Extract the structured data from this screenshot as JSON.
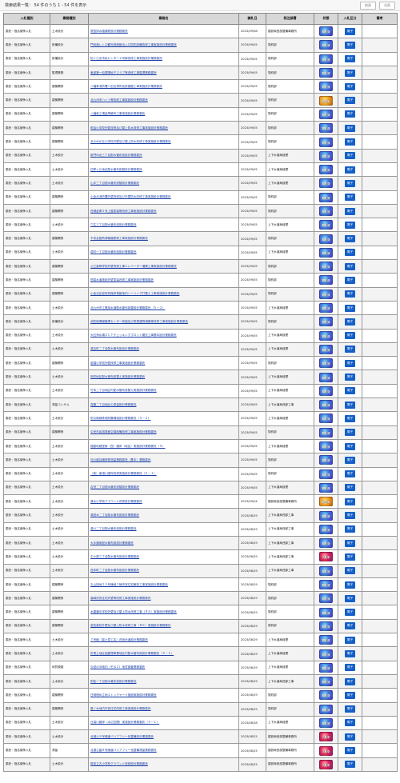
{
  "header": {
    "title": "検索結果一覧： 54 件のうち 1 - 54 件を表示",
    "prev_label": "前頁",
    "next_label": "次頁"
  },
  "columns": [
    "入札種別",
    "業務種別",
    "業務名",
    "開札日",
    "発注部署",
    "状態",
    "入札区分",
    "備考"
  ],
  "colors": {
    "badge_blue": "#3a7fe0",
    "badge_orange": "#f0a020",
    "badge_red": "#e02050",
    "link": "#1a3fa6"
  },
  "rows": [
    {
      "type": "委託・指名競争入札",
      "category": "土木設計",
      "name": "霧島排水路補修設計業務委託",
      "date": "2023/09/08",
      "dept": "建設局西部整備事務所",
      "status": "blue",
      "status_label": "開札済",
      "pdf": "電子"
    },
    {
      "type": "委託・指名競争入札",
      "category": "設備設計",
      "name": "門司港レトロ観光物産館出入口防犯設備改修工事実施設計業務委託",
      "date": "2023/09/05",
      "dept": "契約部",
      "status": "blue",
      "status_label": "開札済",
      "pdf": "電子"
    },
    {
      "type": "委託・指名競争入札",
      "category": "設備設計",
      "name": "松ヶ江北市民センター２号扉改修工事実施設計業務委託",
      "date": "2023/09/05",
      "dept": "契約部",
      "status": "blue",
      "status_label": "開札済",
      "pdf": "電子"
    },
    {
      "type": "委託・指名競争入札",
      "category": "監理業務",
      "name": "東部第一処理場地下スラブ等改修工事監理業務委託",
      "date": "2023/09/05",
      "dept": "契約部",
      "status": "blue",
      "status_label": "開札済",
      "pdf": "電子"
    },
    {
      "type": "委託・指名競争入札",
      "category": "建築関係",
      "name": "八幡東消防署八田出張所仮設建屋工事実施設計業務委託",
      "date": "2023/09/05",
      "dept": "契約部",
      "status": "blue",
      "status_label": "開札済",
      "pdf": "電子"
    },
    {
      "type": "委託・指名競争入札",
      "category": "建築関係",
      "name": "北九州市ハイツ等改修工事実施設計業務委託",
      "date": "2023/09/05",
      "dept": "契約部",
      "status": "orange",
      "status_label": "取止め",
      "pdf": "電子"
    },
    {
      "type": "委託・指名競争入札",
      "category": "建築関係",
      "name": "八幡東工場倉庫解体工事実施設計業務委託",
      "date": "2023/09/05",
      "dept": "契約部",
      "status": "blue",
      "status_label": "開札済",
      "pdf": "電子"
    },
    {
      "type": "委託・指名競争入札",
      "category": "建築関係",
      "name": "明治小学校外壁改修及び屋上防水改修工事実施設計業務委託",
      "date": "2023/09/05",
      "dept": "契約部",
      "status": "blue",
      "status_label": "開札済",
      "pdf": "電子"
    },
    {
      "type": "委託・指名競争入札",
      "category": "建築関係",
      "name": "あやめが丘小学校外壁及び屋上防水改修工事実施設計業務委託",
      "date": "2023/09/05",
      "dept": "契約部",
      "status": "blue",
      "status_label": "開札済",
      "pdf": "電子"
    },
    {
      "type": "委託・指名競争入札",
      "category": "土木設計",
      "name": "新門司北三丁目配水管布設設計業務委託",
      "date": "2023/09/05",
      "dept": "上下水道局経理",
      "status": "blue",
      "status_label": "開札済",
      "pdf": "電子"
    },
    {
      "type": "委託・指名競争入札",
      "category": "土木設計",
      "name": "四季ヶ丘地区配水管布設替設計業務委託",
      "date": "2023/09/05",
      "dept": "上下水道局経理",
      "status": "blue",
      "status_label": "開札済",
      "pdf": "電子"
    },
    {
      "type": "委託・指名競争入札",
      "category": "土木設計",
      "name": "山手三丁目配水管布設替設計業務委託",
      "date": "2023/09/05",
      "dept": "上下水道局経理",
      "status": "blue",
      "status_label": "開札済",
      "pdf": "電子"
    },
    {
      "type": "委託・指名競争入札",
      "category": "建築関係",
      "name": "小倉北消防署外壁改修及び外壁防水改修工事実施設計業務委託",
      "date": "2023/09/05",
      "dept": "契約部",
      "status": "blue",
      "status_label": "開札済",
      "pdf": "電子"
    },
    {
      "type": "委託・指名競争入札",
      "category": "建築関係",
      "name": "西港倉庫５号上屋塗装等改修工事実施設計業務委託",
      "date": "2023/09/05",
      "dept": "契約部",
      "status": "blue",
      "status_label": "開札済",
      "pdf": "電子"
    },
    {
      "type": "委託・指名競争入札",
      "category": "土木設計",
      "name": "穴生三丁目配水管布設設計業務委託",
      "date": "2023/09/05",
      "dept": "上下水道局経理",
      "status": "blue",
      "status_label": "開札済",
      "pdf": "電子"
    },
    {
      "type": "委託・指名競争入札",
      "category": "建築関係",
      "name": "不老会館熱源機器更新工事実施設計業務委託",
      "date": "2023/09/05",
      "dept": "契約部",
      "status": "blue",
      "status_label": "開札済",
      "pdf": "電子"
    },
    {
      "type": "委託・指名競争入札",
      "category": "土木設計",
      "name": "葛町一丁目配水管布設設計業務委託",
      "date": "2023/09/05",
      "dept": "上下水道局経理",
      "status": "blue",
      "status_label": "開札済",
      "pdf": "電子"
    },
    {
      "type": "委託・指名競争入札",
      "category": "建築関係",
      "name": "公立高等学校外壁改修工事エレベーター増築工事実施設計業務委託",
      "date": "2023/09/05",
      "dept": "契約部",
      "status": "blue",
      "status_label": "開札済",
      "pdf": "電子"
    },
    {
      "type": "委託・指名競争入札",
      "category": "建築関係",
      "name": "簡易水道施設外壁塗装改修工事実施設計業務委託",
      "date": "2023/09/05",
      "dept": "契約部",
      "status": "blue",
      "status_label": "開札済",
      "pdf": "電子"
    },
    {
      "type": "委託・指名競争入札",
      "category": "建築関係",
      "name": "小倉北区役所別館体育館地内シーリング打替え工事実施設計業務委託",
      "date": "2023/09/05",
      "dept": "契約部",
      "status": "blue",
      "status_label": "開札済",
      "pdf": "電子"
    },
    {
      "type": "委託・指名競争入札",
      "category": "土木設計",
      "name": "北九州市工業用水道配水管布設替設計業務委託（５－２）",
      "date": "2023/09/05",
      "dept": "上下水道局経理",
      "status": "blue",
      "status_label": "開札済",
      "pdf": "電子"
    },
    {
      "type": "委託・指名競争入札",
      "category": "設備設計",
      "name": "消防局情報管理センター別館及び附属建物増築等改修工事実施設計業務委託",
      "date": "2023/09/05",
      "dept": "契約部",
      "status": "blue",
      "status_label": "開札済",
      "pdf": "電子"
    },
    {
      "type": "委託・指名競争入札",
      "category": "土木設計",
      "name": "大石浄水場ＺＣＴチェッキングプロット撤去工事基本設計業務委託",
      "date": "2023/09/05",
      "dept": "上下水道局経理",
      "status": "blue",
      "status_label": "開札済",
      "pdf": "電子"
    },
    {
      "type": "委託・指名競争入札",
      "category": "土木設計",
      "name": "湯吉町二丁目配水管布設設計業務委託",
      "date": "2023/09/05",
      "dept": "上下水道局経理",
      "status": "blue",
      "status_label": "開札済",
      "pdf": "電子"
    },
    {
      "type": "委託・指名競争入札",
      "category": "建築関係",
      "name": "若園小学校外壁改修工事実施設計業務委託",
      "date": "2023/09/05",
      "dept": "契約部",
      "status": "blue",
      "status_label": "開札済",
      "pdf": "電子"
    },
    {
      "type": "委託・指名競争入札",
      "category": "土木設計",
      "name": "祝町地区配水管布設替え実施設計業務委託",
      "date": "2023/09/05",
      "dept": "上下水道局経理",
      "status": "blue",
      "status_label": "開札済",
      "pdf": "電子"
    },
    {
      "type": "委託・指名競争入札",
      "category": "土木設計",
      "name": "竹末二丁目地区内配水管布設替え実施設計業務委託",
      "date": "2023/09/05",
      "dept": "上下水道局経理",
      "status": "blue",
      "status_label": "開札済",
      "pdf": "電子"
    },
    {
      "type": "委託・指名競争入札",
      "category": "測量コンサル",
      "name": "真鶴二丁目地区の測量設計業務委託",
      "date": "2023/09/05",
      "dept": "上下水道局西部工事",
      "status": "blue",
      "status_label": "開札済",
      "pdf": "電子"
    },
    {
      "type": "委託・指名競争入札",
      "category": "土木設計",
      "name": "防災無線鉄塔耐震補強設計業務委託（５－２）",
      "date": "2023/09/05",
      "dept": "上下水道局経理",
      "status": "blue",
      "status_label": "開札済",
      "pdf": "電子"
    },
    {
      "type": "委託・指名競争入札",
      "category": "建築関係",
      "name": "中央市民図書館空調設備改修工事実施設計業務委託",
      "date": "2023/09/05",
      "dept": "契約部",
      "status": "blue",
      "status_label": "開札済",
      "pdf": "電子"
    },
    {
      "type": "委託・指名競争入札",
      "category": "土木設計",
      "name": "福童地蔵堂東（西）護岸（地区）実施設計業務委託（５）",
      "date": "2023/09/05",
      "dept": "上下水道局経理",
      "status": "blue",
      "status_label": "開札済",
      "pdf": "電子"
    },
    {
      "type": "委託・指名競争入札",
      "category": "土木設計",
      "name": "河川維持補修等測量業務委託（基本）業務委託",
      "date": "2023/09/05",
      "dept": "契約部",
      "status": "blue",
      "status_label": "開札済",
      "pdf": "電子"
    },
    {
      "type": "委託・指名競争入札",
      "category": "土木設計",
      "name": "（新）東港川護岸改修実施設計業務委託（５－１）",
      "date": "2023/09/05",
      "dept": "契約部",
      "status": "blue",
      "status_label": "開札済",
      "pdf": "電子"
    },
    {
      "type": "委託・指名競争入札",
      "category": "土木設計",
      "name": "吉田二丁目配水管布設替設計業務委託",
      "date": "2023/09/05",
      "dept": "上下水道局経理",
      "status": "blue",
      "status_label": "開札済",
      "pdf": "電子"
    },
    {
      "type": "委託・指名競争入札",
      "category": "土木設計",
      "name": "清水小学校グラウンド改修設計業務委託",
      "date": "2023/09/04",
      "dept": "建設局西部整備事務所",
      "status": "orange",
      "status_label": "取止め",
      "pdf": "電子"
    },
    {
      "type": "委託・指名競争入札",
      "category": "土木設計",
      "name": "湯田木二丁目配水管布設設計業務委託",
      "date": "2023/08/29",
      "dept": "上下水道局西部工事",
      "status": "blue",
      "status_label": "開札済",
      "pdf": "電子"
    },
    {
      "type": "委託・指名競争入札",
      "category": "土木設計",
      "name": "湯川二丁目配水管布設設計業務委託",
      "date": "2023/08/29",
      "dept": "上下水道局西部工事",
      "status": "blue",
      "status_label": "開札済",
      "pdf": "電子"
    },
    {
      "type": "委託・指名競争入札",
      "category": "土木設計",
      "name": "大手通街配水管布設設計業務委託",
      "date": "2023/08/29",
      "dept": "上下水道局西部工事",
      "status": "blue",
      "status_label": "開札済",
      "pdf": "電子"
    },
    {
      "type": "委託・指名競争入札",
      "category": "土木設計",
      "name": "中小原三丁目配水管布設設計業務委託",
      "date": "2023/08/29",
      "dept": "上下水道局西部工事",
      "status": "red",
      "status_label": "入札中",
      "pdf": "電子"
    },
    {
      "type": "委託・指名競争入札",
      "category": "土木設計",
      "name": "西本町二丁目配水管布設設計業務委託",
      "date": "2023/08/29",
      "dept": "上下水道局西部工事",
      "status": "blue",
      "status_label": "開札済",
      "pdf": "電子"
    },
    {
      "type": "委託・指名競争入札",
      "category": "建築関係",
      "name": "丸山団地２０号棟他２棟市営住宅解体工事実施設計業務委託",
      "date": "2023/08/29",
      "dept": "契約部",
      "status": "blue",
      "status_label": "開札済",
      "pdf": "電子"
    },
    {
      "type": "委託・指名競争入札",
      "category": "建築関係",
      "name": "高崎改良住宅外壁等改修工事実施設計業務委託",
      "date": "2023/08/29",
      "dept": "契約部",
      "status": "blue",
      "status_label": "開札済",
      "pdf": "電子"
    },
    {
      "type": "委託・指名競争入札",
      "category": "建築関係",
      "name": "木屋瀬中学校外壁及び屋上防水改修工事（Ｒ６）実施設計業務委託",
      "date": "2023/08/29",
      "dept": "契約部",
      "status": "blue",
      "status_label": "開札済",
      "pdf": "電子"
    },
    {
      "type": "委託・指名競争入札",
      "category": "建築関係",
      "name": "若松高校外壁及び屋上防水改修工事（Ｒ６）実施設計業務委託",
      "date": "2023/08/29",
      "dept": "契約部",
      "status": "blue",
      "status_label": "開札済",
      "pdf": "電子"
    },
    {
      "type": "委託・指名競争入札",
      "category": "土木設計",
      "name": "７号線（富士見工区）改良歩道設計業務委託",
      "date": "2023/08/29",
      "dept": "上下水道局経理",
      "status": "blue",
      "status_label": "開札済",
      "pdf": "電子"
    },
    {
      "type": "委託・指名競争入札",
      "category": "土木設計",
      "name": "折尾土地区画整理事業地区内配水管布設設計業務委託（５－１）",
      "date": "2023/08/29",
      "dept": "上下水道局経理",
      "status": "blue",
      "status_label": "開札済",
      "pdf": "電子"
    },
    {
      "type": "委託・指名競争入札",
      "category": "地質調査",
      "name": "久岐の沖地内（その２）地質調査業務委託",
      "date": "2023/08/29",
      "dept": "上下水道局経理",
      "status": "blue",
      "status_label": "開札済",
      "pdf": "電子"
    },
    {
      "type": "委託・指名競争入札",
      "category": "土木設計",
      "name": "則松一丁目配水管布設設計業務委託",
      "date": "2023/08/29",
      "dept": "上下水道局西部工事",
      "status": "blue",
      "status_label": "開札済",
      "pdf": "電子"
    },
    {
      "type": "委託・指名競争入札",
      "category": "建築関係",
      "name": "日明埋め立地ストックヤード施設実施設計業務委託",
      "date": "2023/08/29",
      "dept": "契約部",
      "status": "blue",
      "status_label": "開札済",
      "pdf": "電子"
    },
    {
      "type": "委託・指名競争入札",
      "category": "建築関係",
      "name": "藤ノ木地内市営住宅改修工事実施設計業務委託",
      "date": "2023/08/29",
      "dept": "契約部",
      "status": "blue",
      "status_label": "開札済",
      "pdf": "電子"
    },
    {
      "type": "委託・指名競争入札",
      "category": "土木設計",
      "name": "日高川護岸（水辺空間）実施設計業務委託（５－１）",
      "date": "2023/08/28",
      "dept": "上下水道局経理",
      "status": "blue",
      "status_label": "開札済",
      "pdf": "電子"
    },
    {
      "type": "委託・指名競争入札",
      "category": "土木設計",
      "name": "北浦公８号緑道バリアフリー化整備設計業務委託",
      "date": "2023/08/25",
      "dept": "建設局西部整備事務所",
      "status": "red",
      "status_label": "入札中",
      "pdf": "電子"
    },
    {
      "type": "委託・指名競争入札",
      "category": "測量",
      "name": "北浦公園８号緑道バリアフリー化整備測量業務委託",
      "date": "2023/08/25",
      "dept": "建設局西部整備事務所",
      "status": "red",
      "status_label": "入札中",
      "pdf": "電子"
    },
    {
      "type": "委託・指名競争入札",
      "category": "土木設計",
      "name": "筑前立古小学校グラウンド改修設計業務委託",
      "date": "2023/08/25",
      "dept": "建設局西部整備事務所",
      "status": "red",
      "status_label": "入札中",
      "pdf": "電子"
    }
  ]
}
